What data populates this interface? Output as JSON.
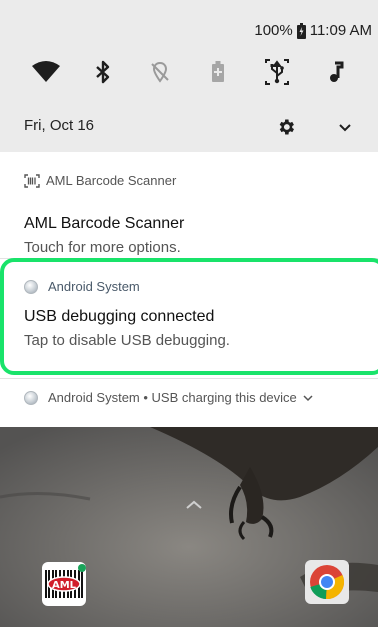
{
  "status": {
    "battery": "100%",
    "time": "11:09 AM"
  },
  "quick_settings": {
    "date": "Fri, Oct 16",
    "tiles": [
      "wifi",
      "bluetooth",
      "location-off",
      "battery-saver",
      "usb",
      "music"
    ]
  },
  "notifications": [
    {
      "app": "AML Barcode Scanner",
      "title": "AML Barcode Scanner",
      "text": "Touch for more options."
    },
    {
      "app": "Android System",
      "title": "USB debugging connected",
      "text": "Tap to disable USB debugging."
    },
    {
      "summary": "Android System • USB charging this device"
    }
  ],
  "home": {
    "apps": [
      "AML",
      "Chrome"
    ]
  },
  "colors": {
    "highlight": "#19e36a",
    "shade": "#ebebeb"
  }
}
